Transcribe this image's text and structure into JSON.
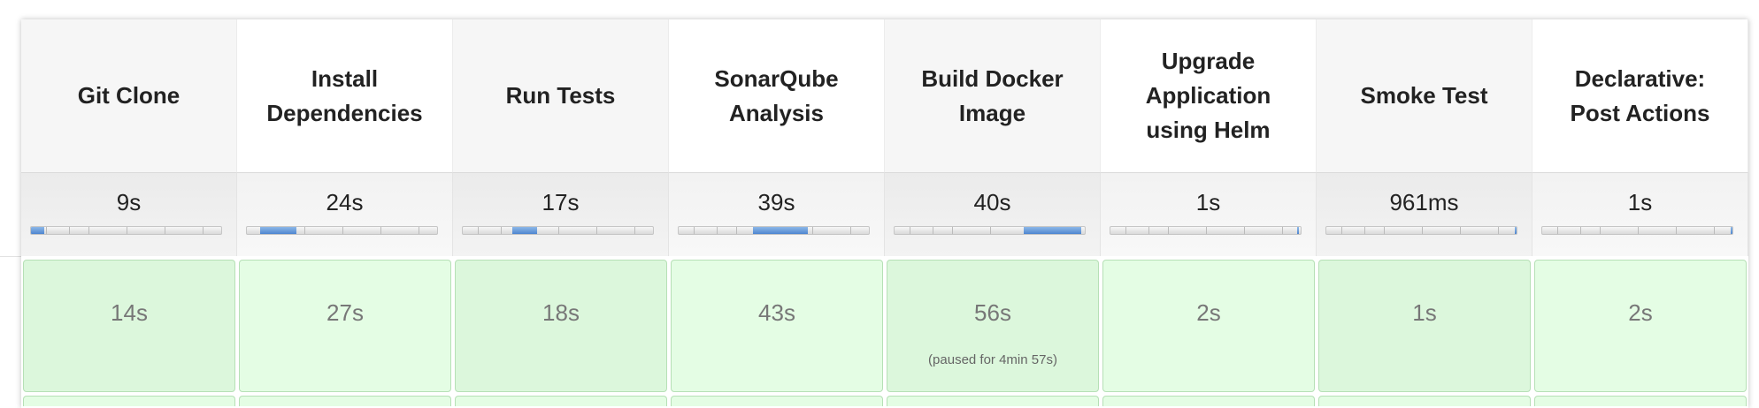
{
  "stages": [
    {
      "name": "Git Clone",
      "avg": "9s",
      "progress": {
        "start": 0.0,
        "end": 0.07
      },
      "run": "14s",
      "note": ""
    },
    {
      "name": "Install Dependencies",
      "avg": "24s",
      "progress": {
        "start": 0.07,
        "end": 0.26
      },
      "run": "27s",
      "note": ""
    },
    {
      "name": "Run Tests",
      "avg": "17s",
      "progress": {
        "start": 0.26,
        "end": 0.39
      },
      "run": "18s",
      "note": ""
    },
    {
      "name": "SonarQube Analysis",
      "avg": "39s",
      "progress": {
        "start": 0.39,
        "end": 0.68
      },
      "run": "43s",
      "note": ""
    },
    {
      "name": "Build Docker Image",
      "avg": "40s",
      "progress": {
        "start": 0.68,
        "end": 0.98
      },
      "run": "56s",
      "note": "(paused for 4min 57s)"
    },
    {
      "name": "Upgrade Application using Helm",
      "avg": "1s",
      "progress": {
        "start": 0.98,
        "end": 0.99
      },
      "run": "2s",
      "note": ""
    },
    {
      "name": "Smoke Test",
      "avg": "961ms",
      "progress": {
        "start": 0.99,
        "end": 1.0
      },
      "run": "1s",
      "note": ""
    },
    {
      "name": "Declarative: Post Actions",
      "avg": "1s",
      "progress": {
        "start": 0.99,
        "end": 1.0
      },
      "run": "2s",
      "note": ""
    }
  ],
  "colors": {
    "progress_fill": "#5b8fd6",
    "success_cell": "#e4fde4",
    "success_border": "#b6e0b6"
  }
}
